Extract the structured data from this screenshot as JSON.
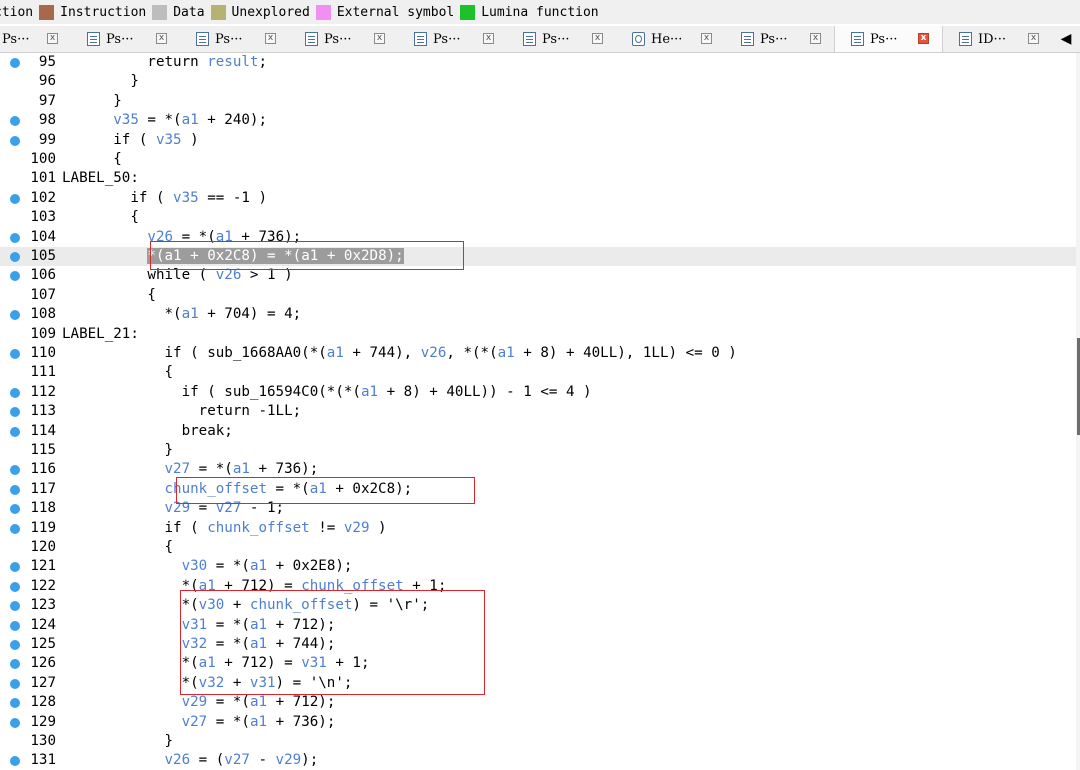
{
  "legend": [
    {
      "label": "ction",
      "color": ""
    },
    {
      "label": "Instruction",
      "color": "#a8694a"
    },
    {
      "label": "Data",
      "color": "#bdbdbd"
    },
    {
      "label": "Unexplored",
      "color": "#b5b272"
    },
    {
      "label": "External symbol",
      "color": "#f28ff2"
    },
    {
      "label": "Lumina function",
      "color": "#1dc22a"
    }
  ],
  "tabs": [
    {
      "label": "Ps···",
      "icon": "pseudocode-icon",
      "close": "x",
      "active": false
    },
    {
      "label": "Ps···",
      "icon": "pseudocode-icon",
      "close": "x",
      "active": false
    },
    {
      "label": "Ps···",
      "icon": "pseudocode-icon",
      "close": "x",
      "active": false
    },
    {
      "label": "Ps···",
      "icon": "pseudocode-icon",
      "close": "x",
      "active": false
    },
    {
      "label": "Ps···",
      "icon": "pseudocode-icon",
      "close": "x",
      "active": false
    },
    {
      "label": "Ps···",
      "icon": "pseudocode-icon",
      "close": "x",
      "active": false
    },
    {
      "label": "He···",
      "icon": "hex-view-icon",
      "close": "x",
      "active": false
    },
    {
      "label": "Ps···",
      "icon": "pseudocode-icon",
      "close": "x",
      "active": false
    },
    {
      "label": "Ps···",
      "icon": "pseudocode-icon",
      "close": "x",
      "active": true
    },
    {
      "label": "ID···",
      "icon": "pseudocode-icon",
      "close": "x",
      "active": false
    }
  ],
  "tab_scroll_arrow": "◀",
  "code_lines": [
    {
      "num": "95",
      "dot": true,
      "text": "          return result;"
    },
    {
      "num": "96",
      "dot": false,
      "text": "        }"
    },
    {
      "num": "97",
      "dot": false,
      "text": "      }"
    },
    {
      "num": "98",
      "dot": true,
      "text": "      v35 = *(a1 + 240);"
    },
    {
      "num": "99",
      "dot": true,
      "text": "      if ( v35 )"
    },
    {
      "num": "100",
      "dot": false,
      "text": "      {"
    },
    {
      "num": "101",
      "dot": false,
      "text": "LABEL_50:"
    },
    {
      "num": "102",
      "dot": true,
      "text": "        if ( v35 == -1 )"
    },
    {
      "num": "103",
      "dot": false,
      "text": "        {"
    },
    {
      "num": "104",
      "dot": true,
      "text": "          v26 = *(a1 + 736);"
    },
    {
      "num": "105",
      "dot": true,
      "text": "          *(a1 + 0x2C8) = *(a1 + 0x2D8);",
      "highlight": true,
      "selected": true
    },
    {
      "num": "106",
      "dot": true,
      "text": "          while ( v26 > 1 )"
    },
    {
      "num": "107",
      "dot": false,
      "text": "          {"
    },
    {
      "num": "108",
      "dot": true,
      "text": "            *(a1 + 704) = 4;"
    },
    {
      "num": "109",
      "dot": false,
      "text": "LABEL_21:"
    },
    {
      "num": "110",
      "dot": true,
      "text": "            if ( sub_1668AA0(*(a1 + 744), v26, *(*(a1 + 8) + 40LL), 1LL) <= 0 )"
    },
    {
      "num": "111",
      "dot": false,
      "text": "            {"
    },
    {
      "num": "112",
      "dot": true,
      "text": "              if ( sub_16594C0(*(*(a1 + 8) + 40LL)) - 1 <= 4 )"
    },
    {
      "num": "113",
      "dot": true,
      "text": "                return -1LL;"
    },
    {
      "num": "114",
      "dot": true,
      "text": "              break;"
    },
    {
      "num": "115",
      "dot": false,
      "text": "            }"
    },
    {
      "num": "116",
      "dot": true,
      "text": "            v27 = *(a1 + 736);"
    },
    {
      "num": "117",
      "dot": true,
      "text": "            chunk_offset = *(a1 + 0x2C8);"
    },
    {
      "num": "118",
      "dot": true,
      "text": "            v29 = v27 - 1;"
    },
    {
      "num": "119",
      "dot": true,
      "text": "            if ( chunk_offset != v29 )"
    },
    {
      "num": "120",
      "dot": false,
      "text": "            {"
    },
    {
      "num": "121",
      "dot": true,
      "text": "              v30 = *(a1 + 0x2E8);"
    },
    {
      "num": "122",
      "dot": true,
      "text": "              *(a1 + 712) = chunk_offset + 1;"
    },
    {
      "num": "123",
      "dot": true,
      "text": "              *(v30 + chunk_offset) = '\\r';"
    },
    {
      "num": "124",
      "dot": true,
      "text": "              v31 = *(a1 + 712);"
    },
    {
      "num": "125",
      "dot": true,
      "text": "              v32 = *(a1 + 744);"
    },
    {
      "num": "126",
      "dot": true,
      "text": "              *(a1 + 712) = v31 + 1;"
    },
    {
      "num": "127",
      "dot": true,
      "text": "              *(v32 + v31) = '\\n';"
    },
    {
      "num": "128",
      "dot": true,
      "text": "              v29 = *(a1 + 712);"
    },
    {
      "num": "129",
      "dot": true,
      "text": "              v27 = *(a1 + 736);"
    },
    {
      "num": "130",
      "dot": false,
      "text": "            }"
    },
    {
      "num": "131",
      "dot": true,
      "text": "            v26 = (v27 - v29);"
    }
  ],
  "variable_tokens": [
    "chunk_offset",
    "result",
    "a1",
    "v26",
    "v27",
    "v29",
    "v30",
    "v31",
    "v32",
    "v35"
  ],
  "colors": {
    "variable": "#4e7fd0",
    "breakpoint_dot": "#3aa0ea",
    "annotation_box": "#d9262f",
    "selection": "#9c9c9c"
  }
}
